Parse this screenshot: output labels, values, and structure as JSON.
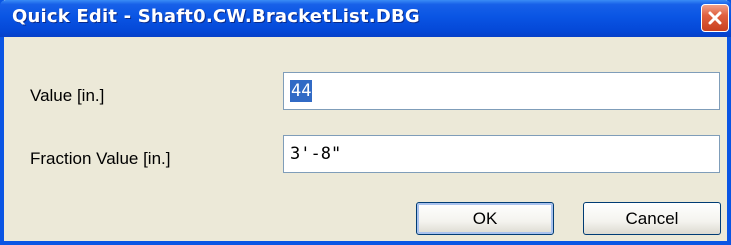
{
  "window": {
    "title": "Quick Edit - Shaft0.CW.BracketList.DBG",
    "close_icon": "close-icon"
  },
  "form": {
    "value_label": "Value [in.]",
    "value": "44",
    "fraction_label": "Fraction Value [in.]",
    "fraction_value": "3'-8\""
  },
  "buttons": {
    "ok_label": "OK",
    "cancel_label": "Cancel"
  },
  "colors": {
    "titlebar": "#0a55e4",
    "selection": "#316ac5",
    "close_button": "#e0603f"
  }
}
